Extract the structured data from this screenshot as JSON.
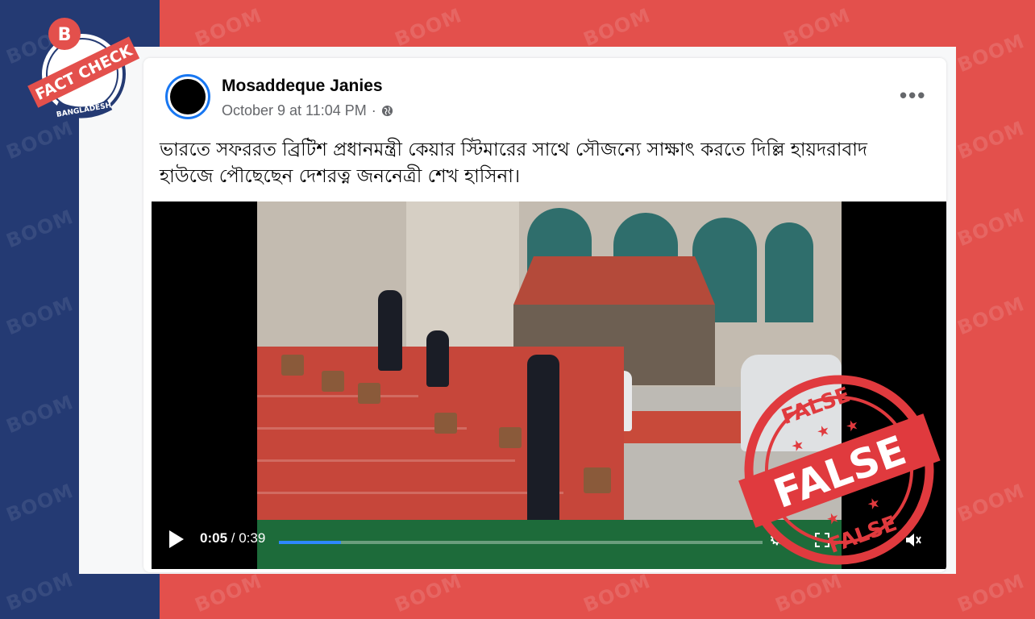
{
  "brand": {
    "watermark": "BOOM",
    "badge_letter": "B",
    "badge_banner": "FACT CHECK",
    "badge_ribbon": "BANGLADESH",
    "colors": {
      "navy": "#243a73",
      "red": "#e3504c",
      "fb_blue": "#1877f2"
    }
  },
  "post": {
    "author": "Mosaddeque Janies",
    "timestamp": "October 9 at 11:04 PM",
    "dot": "·",
    "privacy_icon": "globe-icon",
    "more_icon": "more-options-icon",
    "more_label": "•••",
    "text_line1": "ভারতে সফররত ব্রিটিশ প্রধানমন্ত্রী কেয়ার স্টিমারের সাথে সৌজন্যে সাক্ষাৎ করতে দিল্লি হায়দরাবাদ",
    "text_line2": "হাউজে পৌছেছেন দেশরত্ন জননেত্রী শেখ হাসিনা।"
  },
  "video": {
    "current_time": "0:05",
    "separator": " / ",
    "duration": "0:39",
    "progress_fraction": 0.128,
    "settings_icon": "gear-icon",
    "fullscreen_icon": "fullscreen-icon",
    "volume_icon": "volume-icon"
  },
  "stamp": {
    "label_center": "FALSE",
    "label_top": "FALSE",
    "label_bottom": "FALSE",
    "color": "#e03a3e"
  }
}
